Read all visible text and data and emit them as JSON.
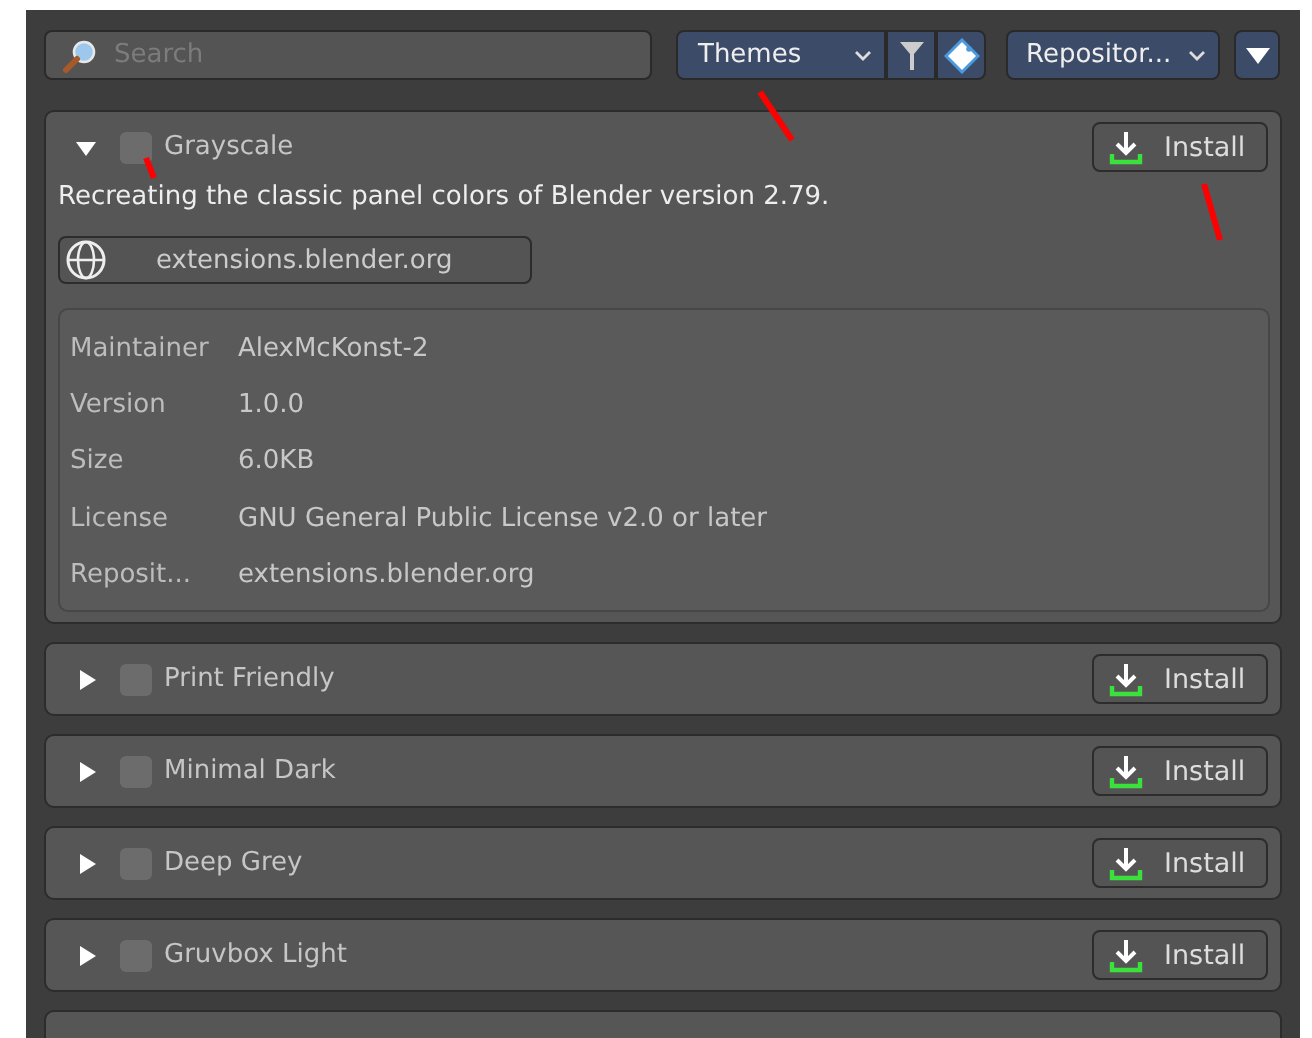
{
  "toolbar": {
    "search": {
      "placeholder": "Search"
    },
    "category": "Themes",
    "repository": "Repositor..."
  },
  "extensions": [
    {
      "name": "Grayscale",
      "expanded": true,
      "checked": false,
      "button": "Install",
      "description": "Recreating the classic panel colors of Blender version 2.79.",
      "website": "extensions.blender.org",
      "details": [
        {
          "label": "Maintainer",
          "value": "AlexMcKonst-2"
        },
        {
          "label": "Version",
          "value": "1.0.0"
        },
        {
          "label": "Size",
          "value": "6.0KB"
        },
        {
          "label": "License",
          "value": "GNU General Public License v2.0 or later"
        },
        {
          "label": "Reposit...",
          "value": "extensions.blender.org"
        }
      ]
    },
    {
      "name": "Print Friendly",
      "expanded": false,
      "checked": false,
      "button": "Install"
    },
    {
      "name": "Minimal Dark",
      "expanded": false,
      "checked": false,
      "button": "Install"
    },
    {
      "name": "Deep Grey",
      "expanded": false,
      "checked": false,
      "button": "Install"
    },
    {
      "name": "Gruvbox Light",
      "expanded": false,
      "checked": false,
      "button": "Install"
    }
  ]
}
